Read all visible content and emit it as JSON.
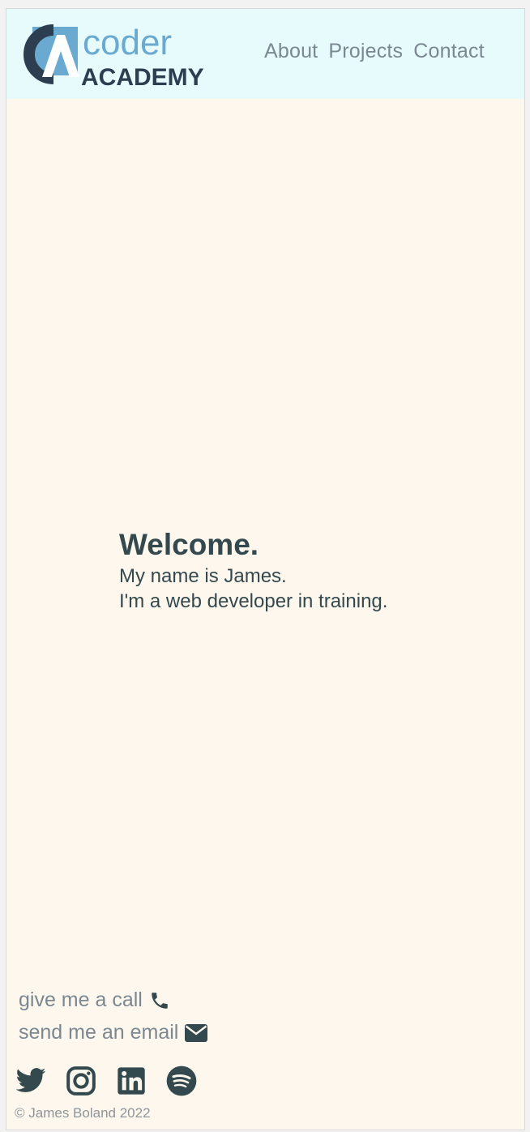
{
  "header": {
    "logo": {
      "line1": "coder",
      "line2": "ACADEMY",
      "monogram": "CA"
    },
    "nav": [
      {
        "label": "About"
      },
      {
        "label": "Projects"
      },
      {
        "label": "Contact"
      }
    ]
  },
  "hero": {
    "heading": "Welcome.",
    "line1": "My name is James.",
    "line2": "I'm a web developer in training."
  },
  "footer": {
    "call_label": "give me a call",
    "call_icon": "phone-icon",
    "email_label": "send me an email",
    "email_icon": "envelope-icon",
    "social": [
      {
        "icon": "twitter-icon"
      },
      {
        "icon": "instagram-icon"
      },
      {
        "icon": "linkedin-icon"
      },
      {
        "icon": "spotify-icon"
      }
    ],
    "copyright": "© James Boland 2022"
  },
  "colors": {
    "header_bg": "#e7fbfd",
    "page_bg": "#fdf7ed",
    "heading": "#34494e",
    "nav_text": "#7b8791",
    "icon": "#34494e",
    "logo_blue": "#6aaad0",
    "logo_dark": "#2c3e50"
  }
}
